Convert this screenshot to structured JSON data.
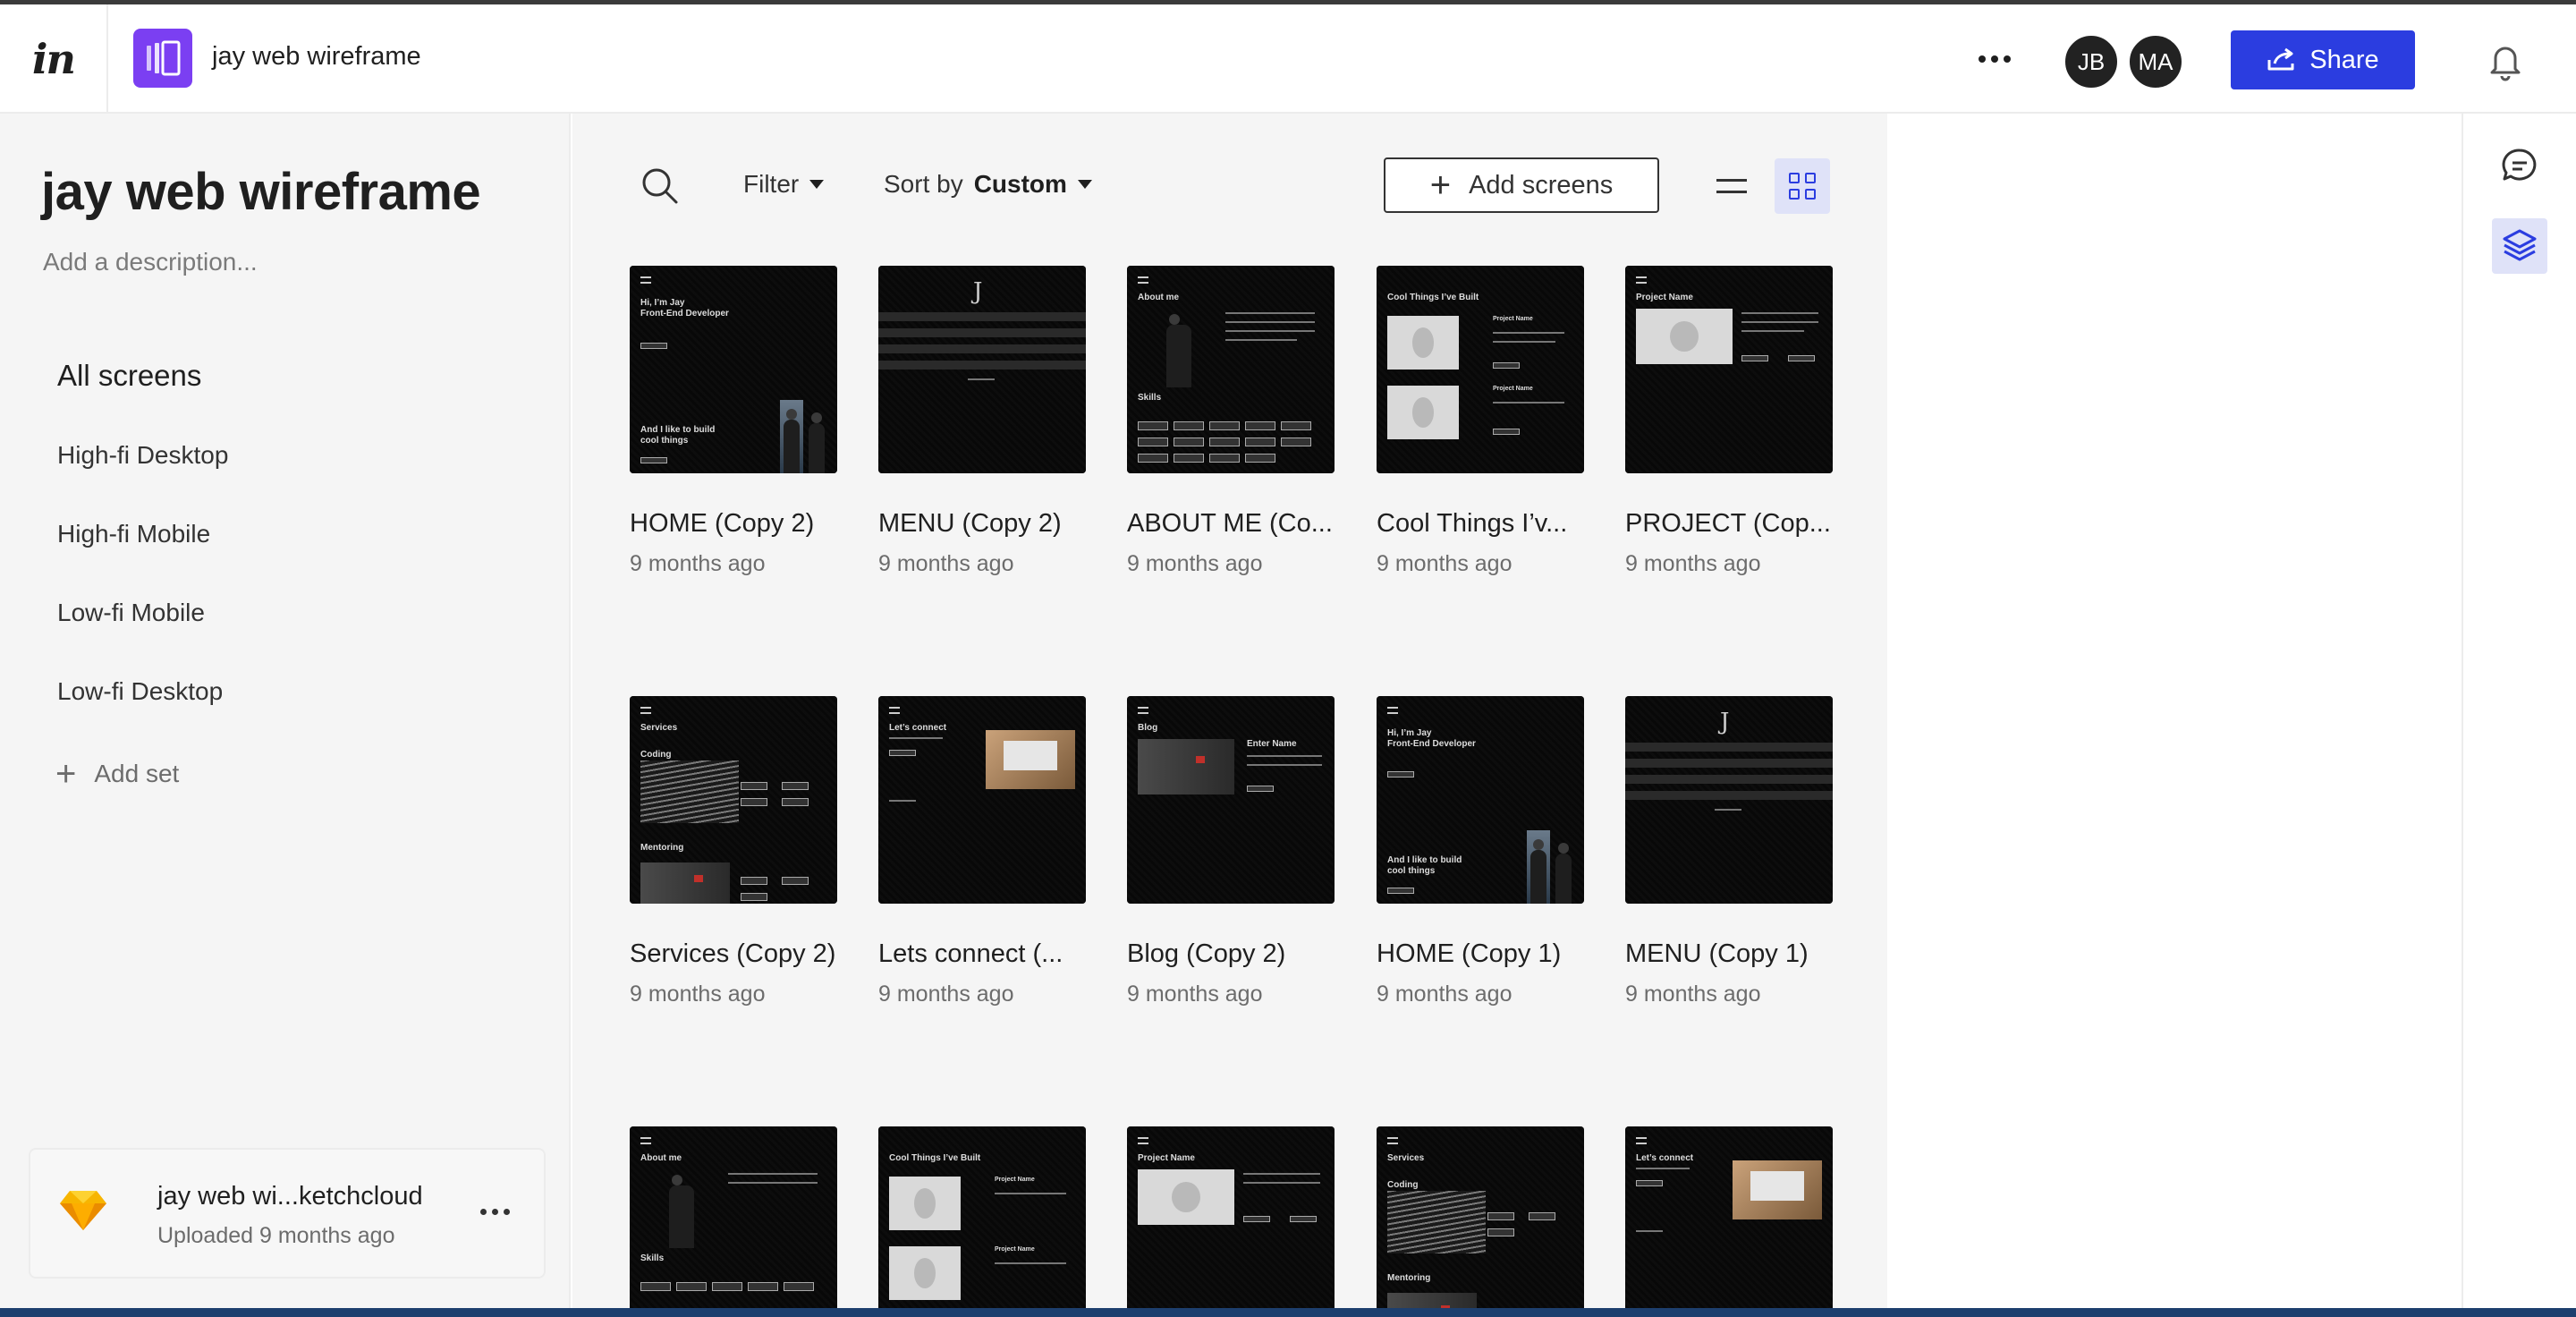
{
  "header": {
    "logo": "in",
    "project_title": "jay web wireframe",
    "avatars": [
      "JB",
      "MA"
    ],
    "share_label": "Share"
  },
  "sidebar": {
    "title": "jay web wireframe",
    "description_placeholder": "Add a description...",
    "all_screens_label": "All screens",
    "sets": [
      "High-fi Desktop",
      "High-fi Mobile",
      "Low-fi Mobile",
      "Low-fi Desktop"
    ],
    "add_set_label": "Add set",
    "upload": {
      "name": "jay web wi...ketchcloud",
      "subtitle": "Uploaded 9 months ago",
      "icon": "sketch-icon"
    }
  },
  "toolbar": {
    "filter_label": "Filter",
    "sort_prefix": "Sort by",
    "sort_value": "Custom",
    "add_screens_label": "Add screens"
  },
  "screens": [
    {
      "name": "HOME (Copy 2)",
      "time": "9 months ago"
    },
    {
      "name": "MENU (Copy 2)",
      "time": "9 months ago"
    },
    {
      "name": "ABOUT ME (Co...",
      "time": "9 months ago"
    },
    {
      "name": "Cool Things I’v...",
      "time": "9 months ago"
    },
    {
      "name": "PROJECT (Cop...",
      "time": "9 months ago"
    },
    {
      "name": "Services (Copy 2)",
      "time": "9 months ago"
    },
    {
      "name": "Lets connect (...",
      "time": "9 months ago"
    },
    {
      "name": "Blog (Copy 2)",
      "time": "9 months ago"
    },
    {
      "name": "HOME (Copy 1)",
      "time": "9 months ago"
    },
    {
      "name": "MENU (Copy 1)",
      "time": "9 months ago"
    }
  ],
  "thumb_text": {
    "home": "Hi, I’m Jay\nFront-End Developer",
    "home_bottom": "And I like to build\ncool things",
    "about": "About me",
    "skills": "Skills",
    "cool": "Cool Things I’ve Built",
    "project": "Project Name",
    "services": "Services",
    "coding": "Coding",
    "mentoring": "Mentoring",
    "connect": "Let’s connect",
    "blog": "Blog",
    "enter_name": "Enter Name",
    "menu_logo": "J"
  },
  "colors": {
    "accent": "#2b3de0",
    "project_icon": "#7b3ff2",
    "selected_bg": "#dfe2f8"
  }
}
